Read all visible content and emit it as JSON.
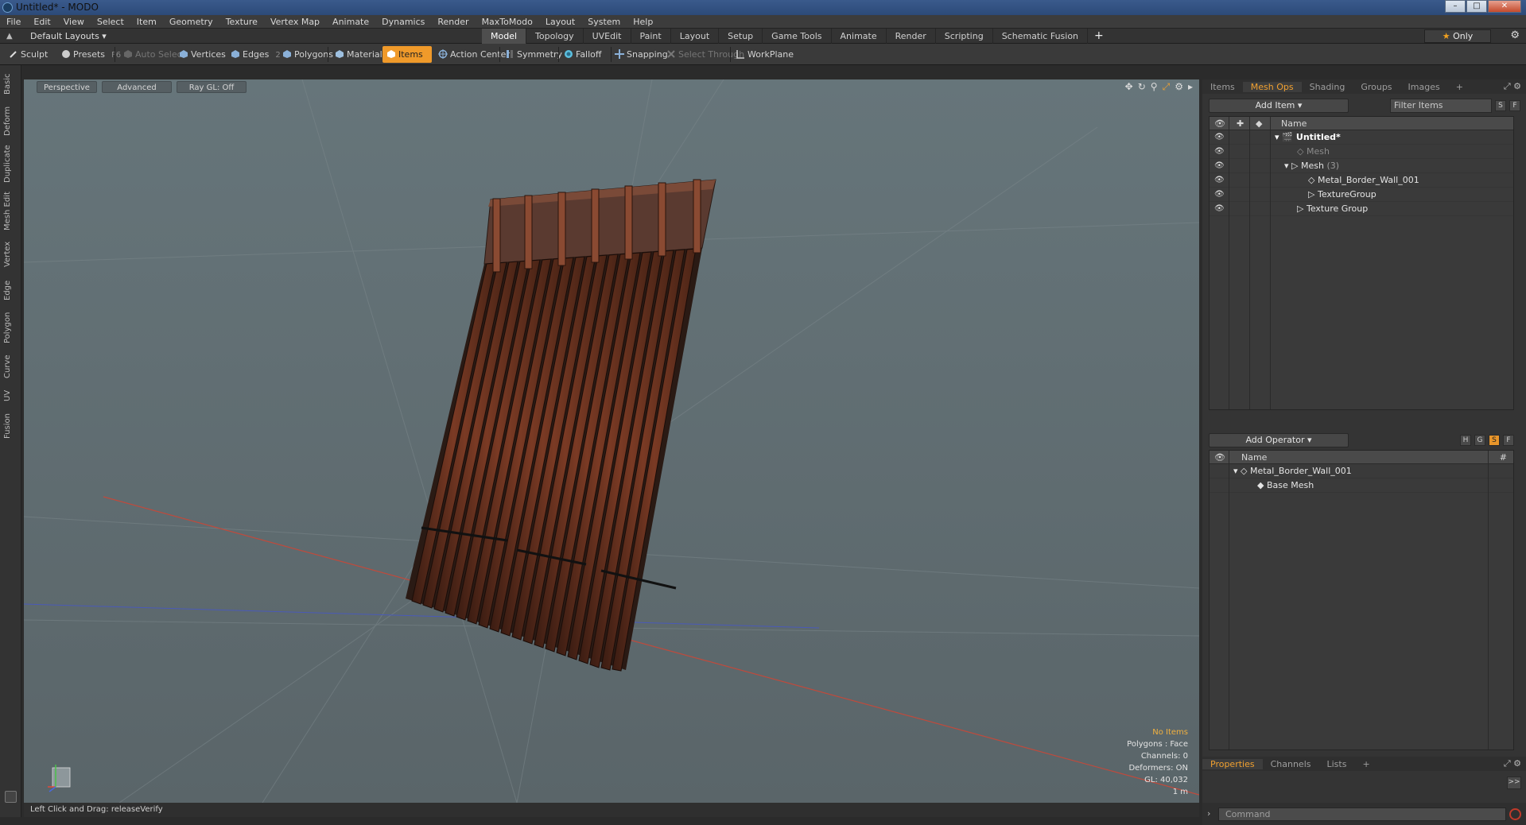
{
  "window": {
    "title": "Untitled* - MODO"
  },
  "menu": [
    "File",
    "Edit",
    "View",
    "Select",
    "Item",
    "Geometry",
    "Texture",
    "Vertex Map",
    "Animate",
    "Dynamics",
    "Render",
    "MaxToModo",
    "Layout",
    "System",
    "Help"
  ],
  "layout": {
    "default_layouts": "Default Layouts ▾",
    "tabs": [
      "Model",
      "Topology",
      "UVEdit",
      "Paint",
      "Layout",
      "Setup",
      "Game Tools",
      "Animate",
      "Render",
      "Scripting",
      "Schematic Fusion"
    ],
    "active_tab": "Model",
    "only_label": "Only"
  },
  "toolbar": {
    "sculpt": "Sculpt",
    "presets": "Presets",
    "presets_key": "F6",
    "auto_select": "Auto Select",
    "vertices": "Vertices",
    "vertices_key": "1",
    "edges": "Edges",
    "edges_key": "2",
    "polygons": "Polygons",
    "materials": "Materials",
    "items": "Items",
    "action_center": "Action Center",
    "symmetry": "Symmetry",
    "falloff": "Falloff",
    "snapping": "Snapping",
    "select_through": "Select Through",
    "workplane": "WorkPlane"
  },
  "left_tabs": [
    "Basic",
    "Deform",
    "Duplicate",
    "Mesh Edit",
    "Vertex",
    "Edge",
    "Polygon",
    "Curve",
    "UV",
    "Fusion"
  ],
  "viewport": {
    "perspective": "Perspective",
    "advanced": "Advanced",
    "raygl": "Ray GL: Off",
    "info": {
      "no_items": "No Items",
      "polygons": "Polygons : Face",
      "channels": "Channels: 0",
      "deformers": "Deformers: ON",
      "gl": "GL: 40,032",
      "scale": "1 m"
    }
  },
  "status": {
    "text": "Left Click and Drag:   releaseVerify"
  },
  "items_panel": {
    "tabs": [
      "Items",
      "Mesh Ops",
      "Shading",
      "Groups",
      "Images"
    ],
    "active_tab": "Mesh Ops",
    "add_item": "Add Item",
    "filter_placeholder": "Filter Items",
    "s_btn": "S",
    "f_btn": "F",
    "name_header": "Name",
    "rows": [
      {
        "label": "Untitled*",
        "indent": 0
      },
      {
        "label": "Mesh",
        "indent": 1
      },
      {
        "label": "Mesh",
        "count": "(3)",
        "indent": 1
      },
      {
        "label": "Metal_Border_Wall_001",
        "indent": 2
      },
      {
        "label": "TextureGroup",
        "indent": 2
      },
      {
        "label": "Texture Group",
        "indent": 1
      }
    ]
  },
  "operators_panel": {
    "add_operator": "Add Operator",
    "h_btn": "H",
    "g_btn": "G",
    "s_btn": "S",
    "f_btn": "F",
    "name_header": "Name",
    "hash_header": "#",
    "rows": [
      {
        "label": "Metal_Border_Wall_001"
      },
      {
        "label": "Base Mesh"
      }
    ]
  },
  "properties_panel": {
    "tabs": [
      "Properties",
      "Channels",
      "Lists"
    ],
    "active_tab": "Properties",
    "more": ">>"
  },
  "command": {
    "placeholder": "Command"
  }
}
